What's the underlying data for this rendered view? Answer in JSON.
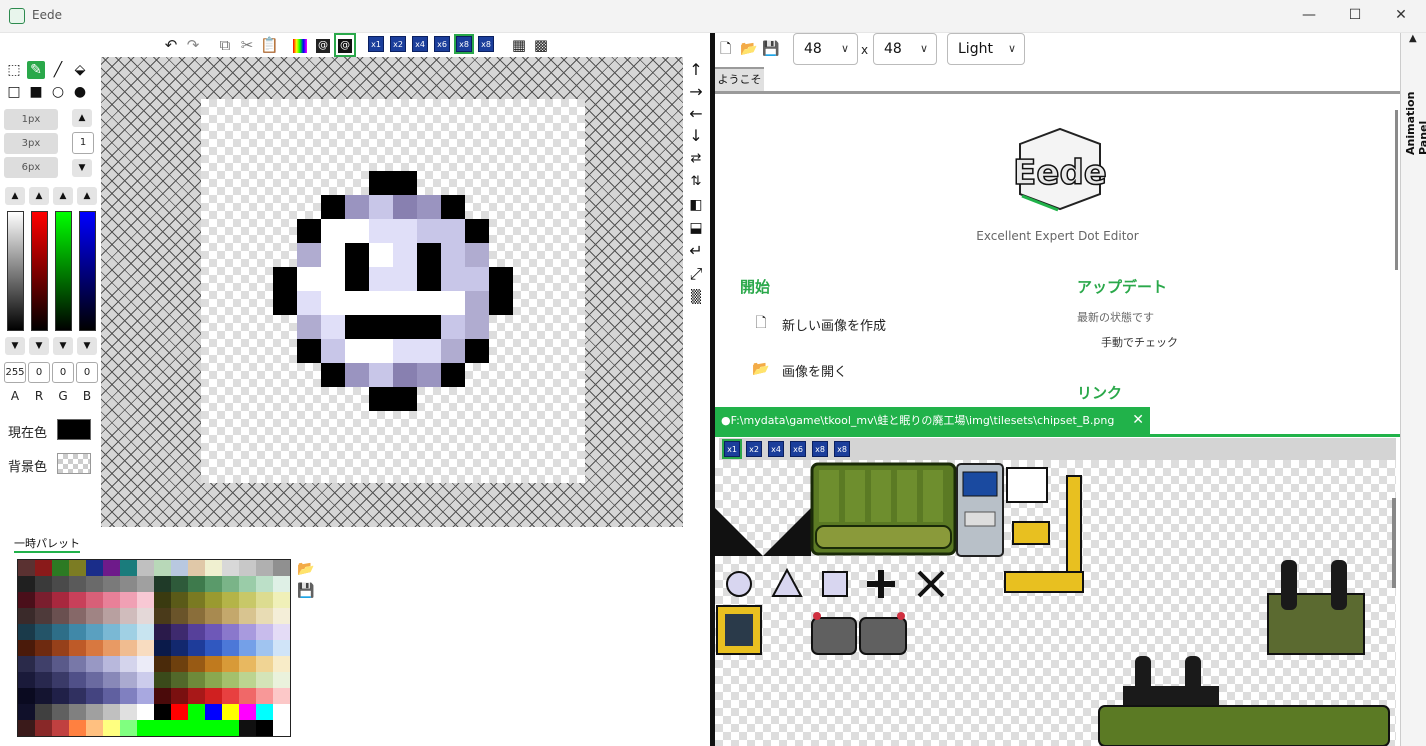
{
  "window": {
    "title": "Eede",
    "minimize_icon": "—",
    "maximize_icon": "☐",
    "close_icon": "✕"
  },
  "toolbar": {
    "scale_buttons": [
      "x1",
      "x2",
      "x4",
      "x6",
      "x8",
      "x8"
    ]
  },
  "pen_sizes": [
    "1px",
    "3px",
    "6px"
  ],
  "pen_size_value": "1",
  "color_channels": {
    "values": [
      "255",
      "0",
      "0",
      "0"
    ],
    "labels": [
      "A",
      "R",
      "G",
      "B"
    ]
  },
  "colors": {
    "current_label": "現在色",
    "background_label": "背景色",
    "current_value": "#000000",
    "accent": "#21b24a"
  },
  "palette": {
    "title": "一時パレット",
    "colors": [
      "#5a3131",
      "#8a1a1a",
      "#2c7a23",
      "#7c7c23",
      "#1a2d8a",
      "#6e1a8a",
      "#1a7c7c",
      "#c0c0c0",
      "#b8d8b8",
      "#b8c8e0",
      "#e0c8a8",
      "#f0f0d0",
      "#d8d8d8",
      "#c8c8c8",
      "#b0b0b0",
      "#909090",
      "#202020",
      "#3a3a3a",
      "#4a4a4a",
      "#5a5a5a",
      "#6a6a6a",
      "#7a7a7a",
      "#8a8a8a",
      "#a0a0a0",
      "#1f3a28",
      "#2e5a3a",
      "#3e7a4c",
      "#5a9a6a",
      "#7ab488",
      "#9acca8",
      "#bce0c8",
      "#dff0e6",
      "#4a0f1a",
      "#7a1e2e",
      "#a8283e",
      "#c8405a",
      "#d86078",
      "#e88098",
      "#f0a0b4",
      "#f8c8d4",
      "#3a3a10",
      "#5a5a18",
      "#7a7a22",
      "#9a9a30",
      "#b4b448",
      "#c8c868",
      "#dcdc90",
      "#f0f0b8",
      "#3a2a2a",
      "#4e3a3a",
      "#6a5050",
      "#866868",
      "#a08484",
      "#b8a0a0",
      "#d0bcbc",
      "#e4d8d8",
      "#4a3a1a",
      "#6a542a",
      "#8a6e3a",
      "#a88a50",
      "#c4a86c",
      "#d8c490",
      "#e8dcb4",
      "#f4eed8",
      "#1a3a4a",
      "#245468",
      "#2e6e88",
      "#4088a8",
      "#5aa0c0",
      "#7ab8d4",
      "#a0d0e4",
      "#c8e4f0",
      "#2a1a4a",
      "#3e2a6e",
      "#56409a",
      "#6e58b8",
      "#8a78cc",
      "#a89ade",
      "#c8bcec",
      "#e4dcf6",
      "#4a1a0a",
      "#6e2a10",
      "#96401a",
      "#be5a28",
      "#d87840",
      "#e89a64",
      "#f0bc90",
      "#f8dcc0",
      "#0a1a4a",
      "#12286e",
      "#1e3c9a",
      "#3058c0",
      "#4c78d8",
      "#74a0e8",
      "#a0c4f0",
      "#d0e4f8",
      "#2a2a4a",
      "#40406a",
      "#5a5a8a",
      "#7878a8",
      "#9898c4",
      "#b8b8dc",
      "#d4d4ec",
      "#ececf8",
      "#4a2a0a",
      "#6e400e",
      "#985a14",
      "#c07a1e",
      "#d89a38",
      "#e8b860",
      "#f0d494",
      "#f8ecc8",
      "#1a1a3a",
      "#28284e",
      "#3a3a68",
      "#505088",
      "#6a6aa0",
      "#8888b8",
      "#aaaad0",
      "#ccccec",
      "#3a4a1a",
      "#52682a",
      "#6e8a3a",
      "#8aa850",
      "#a4c06c",
      "#bcd490",
      "#d4e4b8",
      "#eaf2dc",
      "#0a0a20",
      "#141430",
      "#202048",
      "#303060",
      "#444480",
      "#6060a0",
      "#8080c0",
      "#a8a8e0",
      "#4a0a0a",
      "#7a1010",
      "#a81818",
      "#d02020",
      "#e84040",
      "#f06868",
      "#f89898",
      "#fcc8c8",
      "#10102a",
      "#404040",
      "#606060",
      "#808080",
      "#a0a0a0",
      "#c0c0c0",
      "#e0e0e0",
      "#ffffff",
      "#000000",
      "#ff0000",
      "#00ff00",
      "#0000ff",
      "#ffff00",
      "#ff00ff",
      "#00ffff",
      "#ffffff",
      "#3a1a1a",
      "#882828",
      "#c04040",
      "#ff8040",
      "#ffc080",
      "#ffff80",
      "#80ff80",
      "#00ff00",
      "#00ff00",
      "#00ff00",
      "#00ff00",
      "#00ff00",
      "#00ff00",
      "#101010",
      "#000000",
      "#ffffff"
    ]
  },
  "right_toolbar": {
    "width_value": "48",
    "height_value": "48",
    "separator": "x",
    "theme_value": "Light"
  },
  "welcome": {
    "tab_label": "ようこそ",
    "tagline": "Excellent Expert Dot Editor",
    "logo_text": "Eede",
    "start_heading": "開始",
    "new_image": "新しい画像を作成",
    "open_image": "画像を開く",
    "update_heading": "アップデート",
    "update_status": "最新の状態です",
    "manual_check": "手動でチェック",
    "links_heading": "リンク"
  },
  "tileset_tab": {
    "path": "●F:\\mydata\\game\\tkool_mv\\蛙と眠りの廃工場\\img\\tilesets\\chipset_B.png",
    "close_icon": "✕",
    "scale_buttons": [
      "x1",
      "x2",
      "x4",
      "x6",
      "x8",
      "x8"
    ]
  },
  "animation_panel": {
    "label": "Animation Panel",
    "collapse_icon": "▲"
  }
}
